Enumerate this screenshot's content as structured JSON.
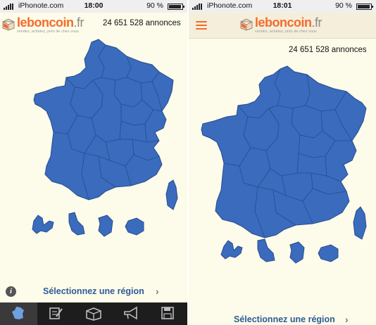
{
  "screens": [
    {
      "status": {
        "carrier": "iPhonote.com",
        "time": "18:00",
        "battery": "90 %",
        "battery_level": 0.9
      },
      "logo": {
        "name": "leboncoin",
        "tld": ".fr",
        "tagline": "vendez, achetez, près de chez vous"
      },
      "listing_count": "24 651 528 annonces",
      "region_selector": "Sélectionnez une région",
      "tabbar": {
        "items": [
          {
            "icon": "france-map-icon",
            "active": true
          },
          {
            "icon": "edit-listing-icon",
            "active": false
          },
          {
            "icon": "package-icon",
            "active": false
          },
          {
            "icon": "megaphone-icon",
            "active": false
          },
          {
            "icon": "save-disk-icon",
            "active": false
          }
        ]
      }
    },
    {
      "status": {
        "carrier": "iPhonote.com",
        "time": "18:01",
        "battery": "90 %",
        "battery_level": 0.9
      },
      "logo": {
        "name": "leboncoin",
        "tld": ".fr",
        "tagline": "vendez, achetez, près de chez vous"
      },
      "listing_count": "24 651 528 annonces",
      "region_selector": "Sélectionnez une région",
      "menu_icon": "hamburger-menu-icon"
    }
  ],
  "colors": {
    "accent": "#f56b2a",
    "map_fill": "#3a6bbd",
    "map_border": "#254c90",
    "link": "#2e5c99",
    "background": "#fdfbe9"
  }
}
